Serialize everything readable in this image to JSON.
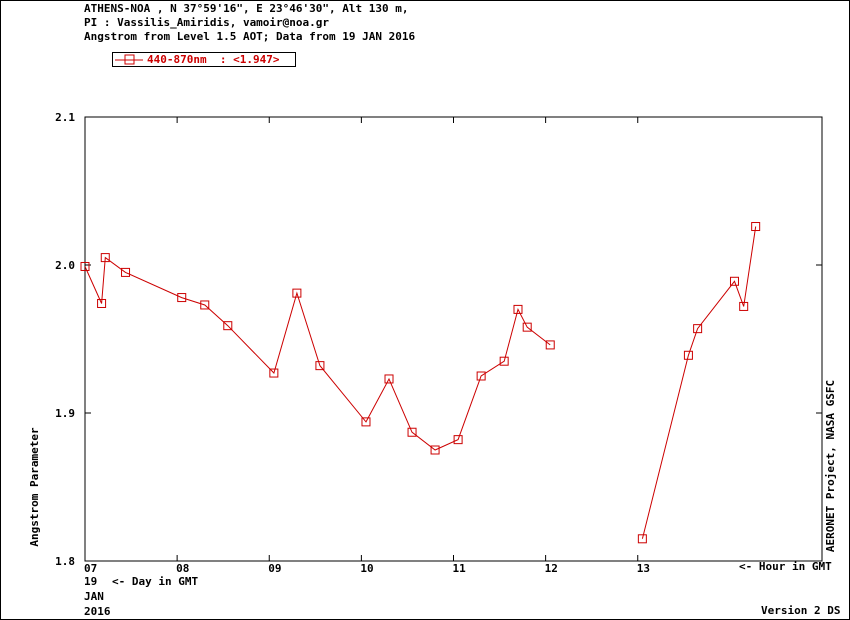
{
  "header": {
    "line1": "ATHENS-NOA , N 37°59'16\", E 23°46'30\", Alt 130 m,",
    "line2": "PI : Vassilis_Amiridis, vamoir@noa.gr",
    "line3": "Angstrom from Level 1.5 AOT; Data from 19 JAN 2016"
  },
  "legend": {
    "label": "440-870nm  : <1.947>",
    "color": "#cc0000"
  },
  "bottom": {
    "day": "19",
    "day_hint": "<- Day in GMT",
    "month": "JAN",
    "year": "2016",
    "hour_hint": "<- Hour in GMT",
    "version": "Version 2 DS"
  },
  "right_label": "AERONET Project, NASA GSFC",
  "chart_data": {
    "type": "line",
    "ylabel": "Angstrom Parameter",
    "xlabel": "",
    "xlim": [
      7,
      15
    ],
    "ylim": [
      1.8,
      2.1
    ],
    "x_ticks": [
      7,
      8,
      9,
      10,
      11,
      12,
      13
    ],
    "x_tick_labels": [
      "07",
      "08",
      "09",
      "10",
      "11",
      "12",
      "13"
    ],
    "y_ticks": [
      1.8,
      1.9,
      2.0,
      2.1
    ],
    "y_tick_labels": [
      "1.8",
      "1.9",
      "2.0",
      "2.1"
    ],
    "series": [
      {
        "name": "440-870nm",
        "color": "#cc0000",
        "segments": [
          {
            "x": [
              7.0,
              7.18,
              7.22,
              7.44,
              8.05,
              8.3,
              8.55,
              9.05,
              9.3,
              9.55,
              10.05,
              10.3,
              10.55,
              10.8,
              11.05,
              11.3,
              11.55,
              11.7,
              11.8,
              12.05
            ],
            "y": [
              1.999,
              1.974,
              2.005,
              1.995,
              1.978,
              1.973,
              1.959,
              1.927,
              1.981,
              1.932,
              1.894,
              1.923,
              1.887,
              1.875,
              1.882,
              1.925,
              1.935,
              1.97,
              1.958,
              1.946
            ]
          },
          {
            "x": [
              13.05,
              13.55,
              13.65,
              14.05,
              14.15,
              14.28
            ],
            "y": [
              1.815,
              1.939,
              1.957,
              1.989,
              1.972,
              2.026
            ]
          }
        ]
      }
    ]
  }
}
